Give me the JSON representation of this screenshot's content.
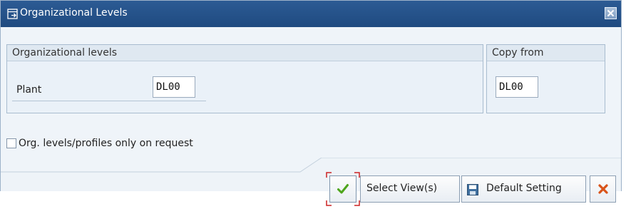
{
  "window": {
    "title": "Organizational Levels",
    "title_icon": "dialog-arrow-icon",
    "close_icon": "close-icon"
  },
  "org_group": {
    "header": "Organizational levels",
    "fields": [
      {
        "label": "Plant",
        "value": "DL00"
      }
    ]
  },
  "copy_group": {
    "header": "Copy from",
    "value": "DL00"
  },
  "options": {
    "org_levels_on_request_label": "Org. levels/profiles only on request",
    "org_levels_on_request_checked": false
  },
  "buttons": {
    "confirm_icon": "checkmark-icon",
    "select_views": "Select View(s)",
    "default_setting": "Default Setting",
    "default_setting_icon": "save-icon",
    "cancel_icon": "cancel-x-icon"
  },
  "colors": {
    "title_bar": "#1f4a80",
    "dialog_bg": "#eff4f9",
    "confirm_check": "#4ea51c",
    "cancel_x": "#d9541a",
    "focus_frame": "#cc2222"
  }
}
